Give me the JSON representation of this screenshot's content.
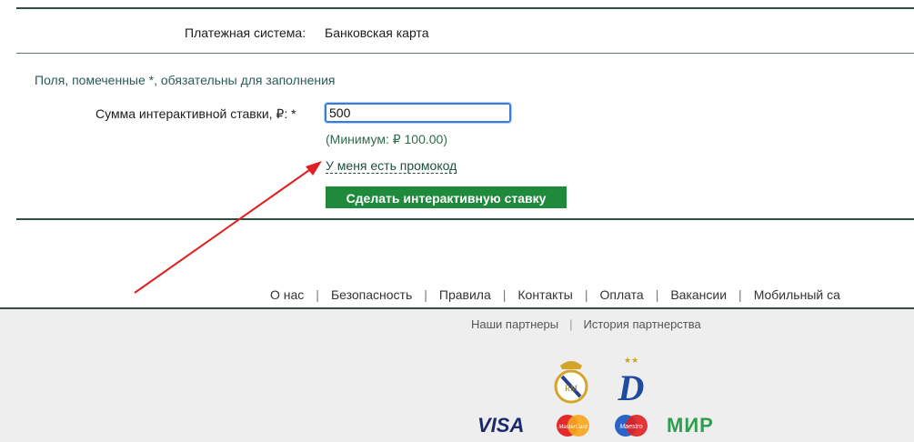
{
  "payment": {
    "label": "Платежная система:",
    "value": "Банковская карта"
  },
  "form": {
    "required_note": "Поля, помеченные *, обязательны для заполнения",
    "amount_label": "Сумма интерактивной ставки, ₽: *",
    "amount_value": "500",
    "minimum_note": "(Минимум: ₽ 100.00)",
    "promo_link": "У меня есть промокод",
    "submit_label": "Сделать интерактивную ставку"
  },
  "footer": {
    "nav": [
      "О нас",
      "Безопасность",
      "Правила",
      "Контакты",
      "Оплата",
      "Вакансии",
      "Мобильный са"
    ],
    "partners": [
      "Наши партнеры",
      "История партнерства"
    ],
    "payment_logos": [
      "VISA",
      "MasterCard",
      "Maestro",
      "МИР"
    ],
    "maestro_text": "Maestro",
    "mastercard_text": "MasterCard"
  },
  "colors": {
    "accent_green": "#1f8a3c",
    "annotation_arrow": "#e02020",
    "input_focus": "#3b78d8"
  },
  "icons": [
    "real-madrid-crest-icon",
    "dynamo-logo-icon",
    "annotation-arrow"
  ]
}
